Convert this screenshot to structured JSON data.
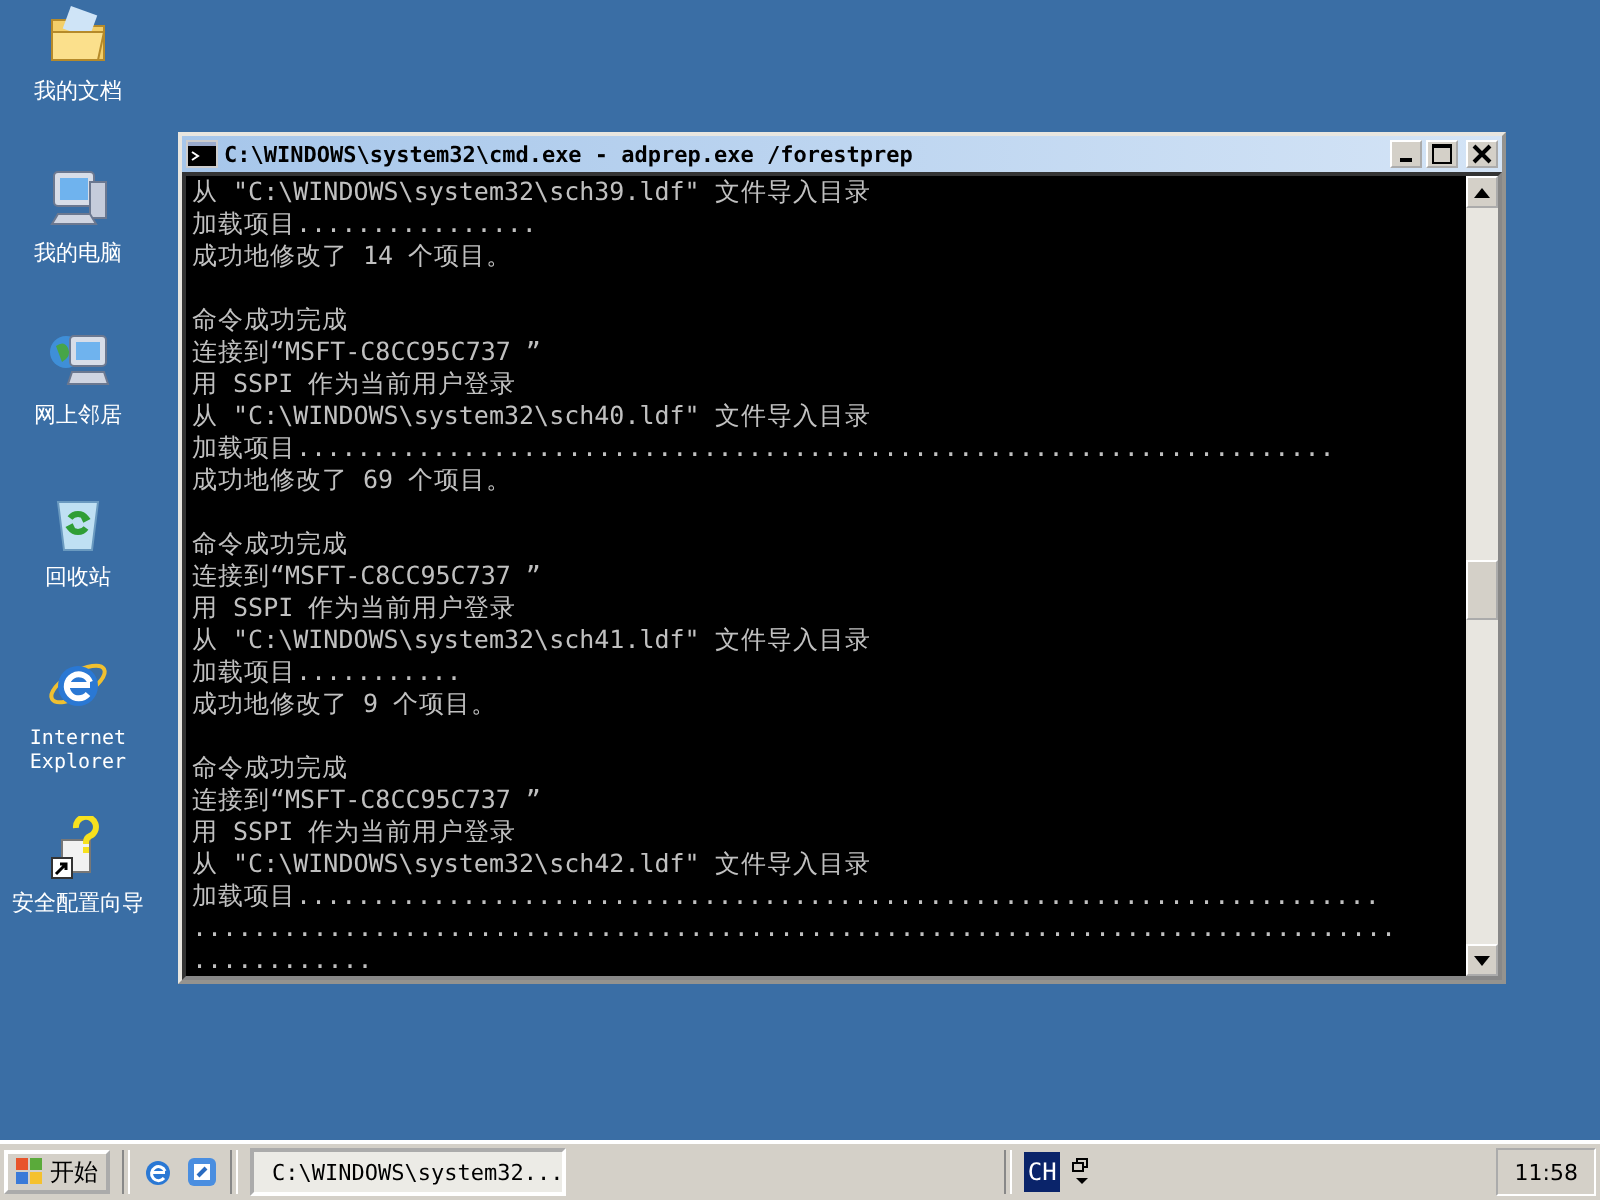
{
  "desktop_icons": [
    {
      "kind": "documents",
      "label": "我的文档"
    },
    {
      "kind": "computer",
      "label": "我的电脑"
    },
    {
      "kind": "network",
      "label": "网上邻居"
    },
    {
      "kind": "recycle",
      "label": "回收站"
    },
    {
      "kind": "ie",
      "label": "Internet Explorer"
    },
    {
      "kind": "wizard",
      "label": "安全配置向导"
    }
  ],
  "window": {
    "title": "C:\\WINDOWS\\system32\\cmd.exe - adprep.exe /forestprep",
    "blocks": [
      [
        "从 \"C:\\WINDOWS\\system32\\sch39.ldf\" 文件导入目录",
        "加载项目................",
        "成功地修改了 14 个项目。"
      ],
      [
        "命令成功完成",
        "连接到“MSFT-C8CC95C737 ”",
        "用 SSPI 作为当前用户登录",
        "从 \"C:\\WINDOWS\\system32\\sch40.ldf\" 文件导入目录",
        "加载项目.....................................................................",
        "成功地修改了 69 个项目。"
      ],
      [
        "命令成功完成",
        "连接到“MSFT-C8CC95C737 ”",
        "用 SSPI 作为当前用户登录",
        "从 \"C:\\WINDOWS\\system32\\sch41.ldf\" 文件导入目录",
        "加载项目...........",
        "成功地修改了 9 个项目。"
      ],
      [
        "命令成功完成",
        "连接到“MSFT-C8CC95C737 ”",
        "用 SSPI 作为当前用户登录",
        "从 \"C:\\WINDOWS\\system32\\sch42.ldf\" 文件导入目录",
        "加载项目........................................................................",
        "................................................................................",
        "............"
      ]
    ]
  },
  "taskbar": {
    "start_label": "开始",
    "quick_launch": [
      {
        "kind": "ie"
      },
      {
        "kind": "desktop"
      }
    ],
    "task": "C:\\WINDOWS\\system32...",
    "language": "CH",
    "clock": "11:58"
  }
}
